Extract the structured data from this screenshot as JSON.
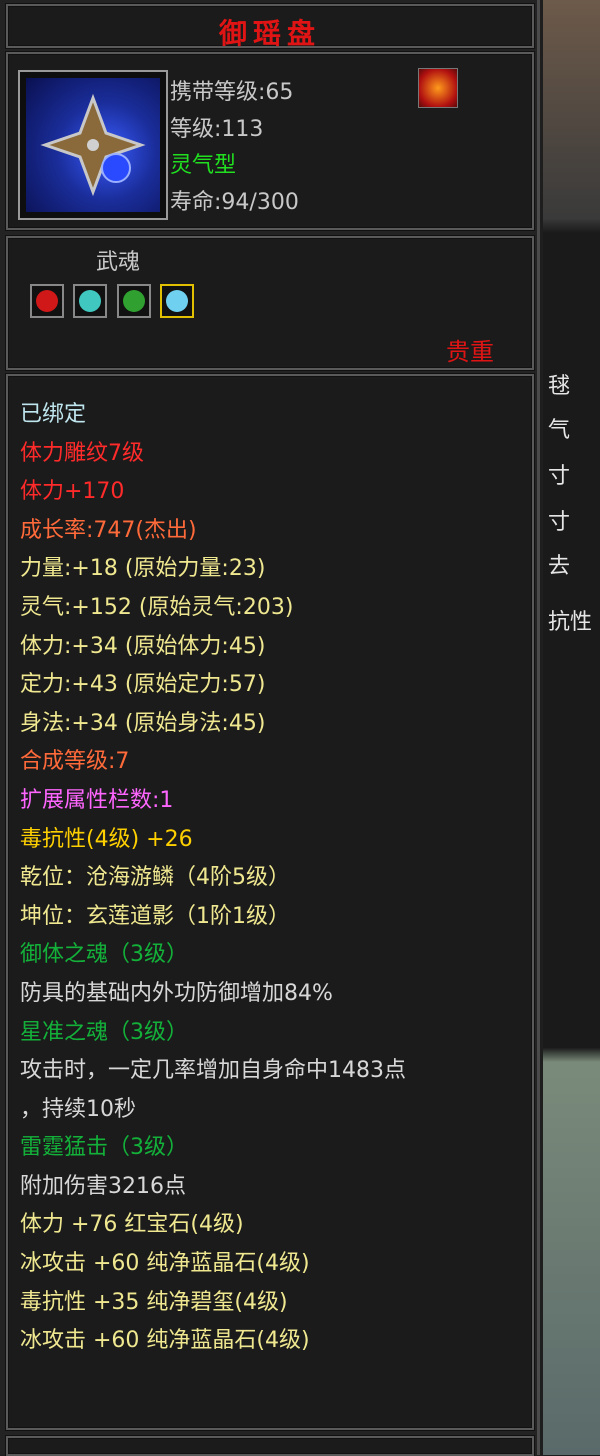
{
  "item": {
    "name": "御瑶盘",
    "carry_level": "携带等级:65",
    "level": "等级:113",
    "type": "灵气型",
    "life": "寿命:94/300",
    "soul_label": "武魂",
    "rarity": "贵重"
  },
  "gems": [
    {
      "color": "#d01818"
    },
    {
      "color": "#40c8c0"
    },
    {
      "color": "#30a030"
    },
    {
      "color": "#70d0f0"
    }
  ],
  "details": [
    {
      "text": "已绑定",
      "color": "cyan"
    },
    {
      "text": "体力雕纹7级",
      "color": "red"
    },
    {
      "text": "体力+170",
      "color": "red"
    },
    {
      "text": "成长率:747(杰出)",
      "color": "orange"
    },
    {
      "text": "力量:+18 (原始力量:23)",
      "color": "yellow"
    },
    {
      "text": "灵气:+152 (原始灵气:203)",
      "color": "yellow"
    },
    {
      "text": "体力:+34 (原始体力:45)",
      "color": "yellow"
    },
    {
      "text": "定力:+43 (原始定力:57)",
      "color": "yellow"
    },
    {
      "text": "身法:+34 (原始身法:45)",
      "color": "yellow"
    },
    {
      "text": "合成等级:7",
      "color": "orange"
    },
    {
      "text": "扩展属性栏数:1",
      "color": "pink"
    },
    {
      "text": "毒抗性(4级) +26",
      "color": "gold"
    },
    {
      "text": "乾位：沧海游鳞（4阶5级）",
      "color": "yellow"
    },
    {
      "text": "坤位：玄莲道影（1阶1级）",
      "color": "yellow"
    },
    {
      "text": "御体之魂（3级）",
      "color": "green"
    },
    {
      "text": "防具的基础内外功防御增加84%",
      "color": "white"
    },
    {
      "text": "星准之魂（3级）",
      "color": "green"
    },
    {
      "text": "攻击时，一定几率增加自身命中1483点",
      "color": "white"
    },
    {
      "text": "，持续10秒",
      "color": "white"
    },
    {
      "text": "雷霆猛击（3级）",
      "color": "green"
    },
    {
      "text": "附加伤害3216点",
      "color": "white"
    },
    {
      "text": "体力 +76 红宝石(4级)",
      "color": "yellow"
    },
    {
      "text": "冰攻击 +60 纯净蓝晶石(4级)",
      "color": "yellow"
    },
    {
      "text": "毒抗性 +35 纯净碧玺(4级)",
      "color": "yellow"
    },
    {
      "text": "冰攻击 +60 纯净蓝晶石(4级)",
      "color": "yellow"
    }
  ],
  "background": {
    "chars": [
      "毬",
      "：",
      "气",
      "寸",
      "寸",
      "去",
      "抗性"
    ]
  }
}
